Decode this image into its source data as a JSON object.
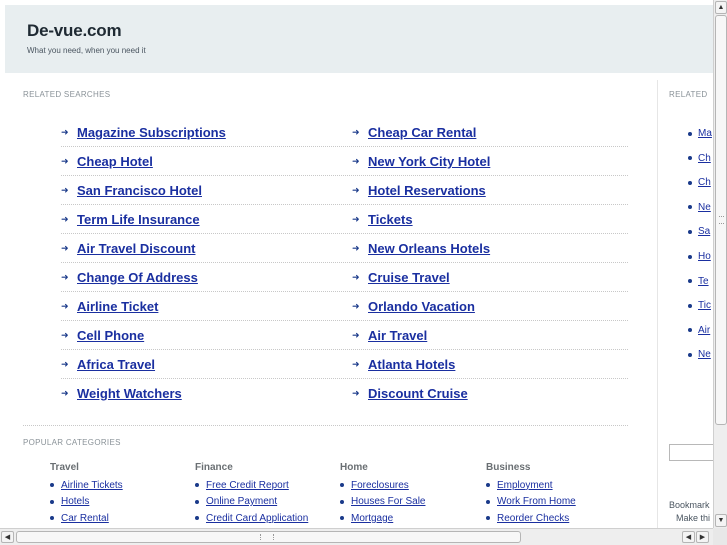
{
  "header": {
    "title": "De-vue.com",
    "tagline": "What you need, when you need it"
  },
  "related": {
    "label": "RELATED SEARCHES",
    "left": [
      "Magazine Subscriptions",
      "Cheap Hotel",
      "San Francisco Hotel",
      "Term Life Insurance",
      "Air Travel Discount",
      "Change Of Address",
      "Airline Ticket",
      "Cell Phone",
      "Africa Travel",
      "Weight Watchers"
    ],
    "right": [
      "Cheap Car Rental",
      "New York City Hotel",
      "Hotel Reservations",
      "Tickets",
      "New Orleans Hotels",
      "Cruise Travel",
      "Orlando Vacation",
      "Air Travel",
      "Atlanta Hotels",
      "Discount Cruise"
    ]
  },
  "popular": {
    "label": "POPULAR CATEGORIES",
    "categories": [
      {
        "title": "Travel",
        "items": [
          "Airline Tickets",
          "Hotels",
          "Car Rental"
        ]
      },
      {
        "title": "Finance",
        "items": [
          "Free Credit Report",
          "Online Payment",
          "Credit Card Application"
        ]
      },
      {
        "title": "Home",
        "items": [
          "Foreclosures",
          "Houses For Sale",
          "Mortgage"
        ]
      },
      {
        "title": "Business",
        "items": [
          "Employment",
          "Work From Home",
          "Reorder Checks"
        ]
      }
    ]
  },
  "sidebar": {
    "label": "RELATED",
    "items": [
      "Ma",
      "Ch",
      "Ch",
      "Ne",
      "Sa",
      "Ho",
      "Te",
      "Tic",
      "Air",
      "Ne"
    ],
    "bookmark": "Bookmark",
    "make": "Make thi"
  },
  "scrollbars": {
    "up_arrow": "▲",
    "down_arrow": "▼",
    "left_arrow": "◀",
    "right_arrow": "▶"
  },
  "arrow_glyph": "➜"
}
